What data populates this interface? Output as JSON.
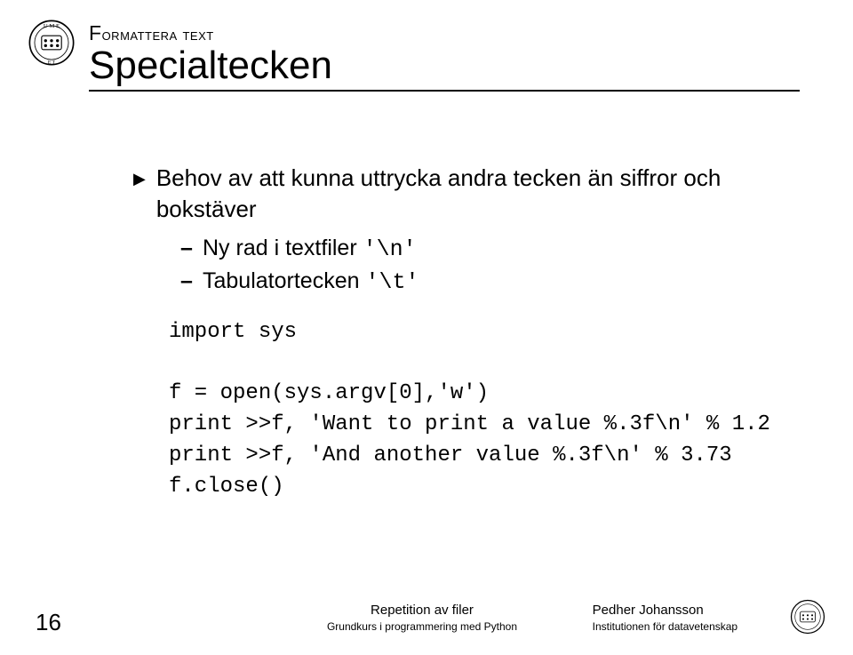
{
  "logo_alt": "University seal",
  "header": {
    "eyebrow": "Formattera text",
    "title": "Specialtecken"
  },
  "bullet": {
    "main": "Behov av att kunna uttrycka andra tecken än siffror och bokstäver",
    "sub1_text": "Ny rad i textfiler ",
    "sub1_code": "'\\n'",
    "sub2_text": "Tabulatortecken ",
    "sub2_code": "'\\t'"
  },
  "code": {
    "l1": "import sys",
    "l2": "",
    "l3": "f = open(sys.argv[0],'w')",
    "l4": "print >>f, 'Want to print a value %.3f\\n' % 1.2",
    "l5": "print >>f, 'And another value %.3f\\n' % 3.73",
    "l6": "f.close()"
  },
  "footer": {
    "page": "16",
    "center_title": "Repetition av filer",
    "center_sub": "Grundkurs i programmering med Python",
    "author_name": "Pedher Johansson",
    "author_dept": "Institutionen för datavetenskap"
  }
}
